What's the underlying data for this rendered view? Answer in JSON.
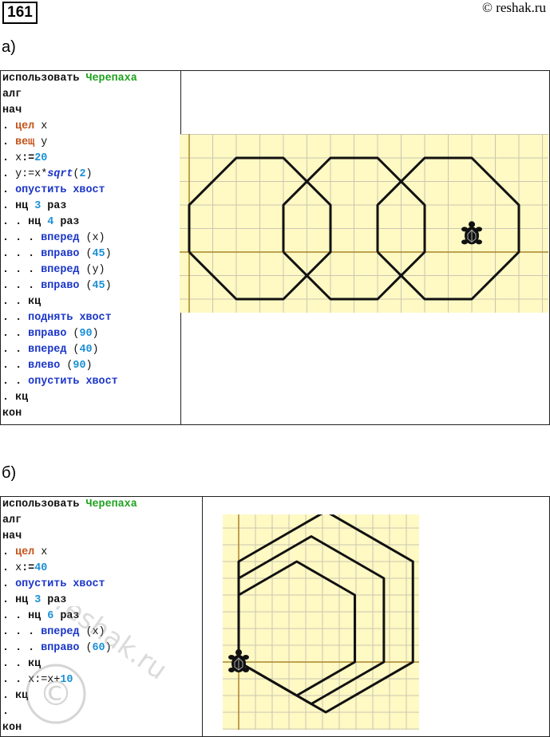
{
  "header": {
    "task_number": "161",
    "site": "© reshak.ru"
  },
  "watermark_text": "reshak.ru",
  "part_a": {
    "label": "а)",
    "code": [
      [
        [
          "kw c-black",
          "использовать "
        ],
        [
          "kw c-green",
          "Черепаха"
        ]
      ],
      [
        [
          "kw c-black",
          "алг"
        ]
      ],
      [
        [
          "kw c-black",
          "нач"
        ]
      ],
      [
        [
          "kw c-black",
          ". "
        ],
        [
          "kw c-orange",
          "цел"
        ],
        [
          "c-plain",
          " x"
        ]
      ],
      [
        [
          "kw c-black",
          ". "
        ],
        [
          "kw c-orange",
          "вещ"
        ],
        [
          "c-plain",
          " y"
        ]
      ],
      [
        [
          "kw c-black",
          ". "
        ],
        [
          "c-plain",
          "x"
        ],
        [
          "kw c-black",
          ":="
        ],
        [
          "kw c-num",
          "20"
        ]
      ],
      [
        [
          "kw c-black",
          ". "
        ],
        [
          "c-plain",
          "y:=x*"
        ],
        [
          "fn",
          "sqrt"
        ],
        [
          "c-plain",
          "("
        ],
        [
          "kw c-num",
          "2"
        ],
        [
          "c-plain",
          ")"
        ]
      ],
      [
        [
          "kw c-black",
          ". "
        ],
        [
          "kw c-blue",
          "опустить хвост"
        ]
      ],
      [
        [
          "kw c-black",
          ". нц "
        ],
        [
          "kw c-num",
          "3"
        ],
        [
          "kw c-black",
          " раз"
        ]
      ],
      [
        [
          "kw c-black",
          ". . нц "
        ],
        [
          "kw c-num",
          "4"
        ],
        [
          "kw c-black",
          " раз"
        ]
      ],
      [
        [
          "kw c-black",
          ". . . "
        ],
        [
          "kw c-blue",
          "вперед"
        ],
        [
          "c-plain",
          " (x)"
        ]
      ],
      [
        [
          "kw c-black",
          ". . . "
        ],
        [
          "kw c-blue",
          "вправо"
        ],
        [
          "c-plain",
          " ("
        ],
        [
          "kw c-num",
          "45"
        ],
        [
          "c-plain",
          ")"
        ]
      ],
      [
        [
          "kw c-black",
          ". . . "
        ],
        [
          "kw c-blue",
          "вперед"
        ],
        [
          "c-plain",
          " (y)"
        ]
      ],
      [
        [
          "kw c-black",
          ". . . "
        ],
        [
          "kw c-blue",
          "вправо"
        ],
        [
          "c-plain",
          " ("
        ],
        [
          "kw c-num",
          "45"
        ],
        [
          "c-plain",
          ")"
        ]
      ],
      [
        [
          "kw c-black",
          ". . кц"
        ]
      ],
      [
        [
          "kw c-black",
          ". . "
        ],
        [
          "kw c-blue",
          "поднять хвост"
        ]
      ],
      [
        [
          "kw c-black",
          ". . "
        ],
        [
          "kw c-blue",
          "вправо"
        ],
        [
          "c-plain",
          " ("
        ],
        [
          "kw c-num",
          "90"
        ],
        [
          "c-plain",
          ")"
        ]
      ],
      [
        [
          "kw c-black",
          ". . "
        ],
        [
          "kw c-blue",
          "вперед"
        ],
        [
          "c-plain",
          " ("
        ],
        [
          "kw c-num",
          "40"
        ],
        [
          "c-plain",
          ")"
        ]
      ],
      [
        [
          "kw c-black",
          ". . "
        ],
        [
          "kw c-blue",
          "влево"
        ],
        [
          "c-plain",
          " ("
        ],
        [
          "kw c-num",
          "90"
        ],
        [
          "c-plain",
          ")"
        ]
      ],
      [
        [
          "kw c-black",
          ". . "
        ],
        [
          "kw c-blue",
          "опустить хвост"
        ]
      ],
      [
        [
          "kw c-black",
          ". кц"
        ]
      ],
      [
        [
          "kw c-black",
          "кон"
        ]
      ]
    ]
  },
  "part_b": {
    "label": "б)",
    "code": [
      [
        [
          "kw c-black",
          "использовать "
        ],
        [
          "kw c-green",
          "Черепаха"
        ]
      ],
      [
        [
          "kw c-black",
          "алг"
        ]
      ],
      [
        [
          "kw c-black",
          "нач"
        ]
      ],
      [
        [
          "kw c-black",
          ". "
        ],
        [
          "kw c-orange",
          "цел"
        ],
        [
          "c-plain",
          " x"
        ]
      ],
      [
        [
          "kw c-black",
          ". "
        ],
        [
          "c-plain",
          "x"
        ],
        [
          "kw c-black",
          ":="
        ],
        [
          "kw c-num",
          "40"
        ]
      ],
      [
        [
          "kw c-black",
          ". "
        ],
        [
          "kw c-blue",
          "опустить хвост"
        ]
      ],
      [
        [
          "kw c-black",
          ". нц "
        ],
        [
          "kw c-num",
          "3"
        ],
        [
          "kw c-black",
          " раз"
        ]
      ],
      [
        [
          "kw c-black",
          ". . нц "
        ],
        [
          "kw c-num",
          "6"
        ],
        [
          "kw c-black",
          " раз"
        ]
      ],
      [
        [
          "kw c-black",
          ". . . "
        ],
        [
          "kw c-blue",
          "вперед"
        ],
        [
          "c-plain",
          " (x)"
        ]
      ],
      [
        [
          "kw c-black",
          ". . . "
        ],
        [
          "kw c-blue",
          "вправо"
        ],
        [
          "c-plain",
          " ("
        ],
        [
          "kw c-num",
          "60"
        ],
        [
          "c-plain",
          ")"
        ]
      ],
      [
        [
          "kw c-black",
          ". . кц"
        ]
      ],
      [
        [
          "kw c-black",
          ". . "
        ],
        [
          "c-plain",
          "x:=x+"
        ],
        [
          "kw c-num",
          "10"
        ]
      ],
      [
        [
          "kw c-black",
          ". кц"
        ]
      ],
      [
        [
          "kw c-black",
          "."
        ]
      ],
      [
        [
          "kw c-black",
          "кон"
        ]
      ]
    ]
  }
}
